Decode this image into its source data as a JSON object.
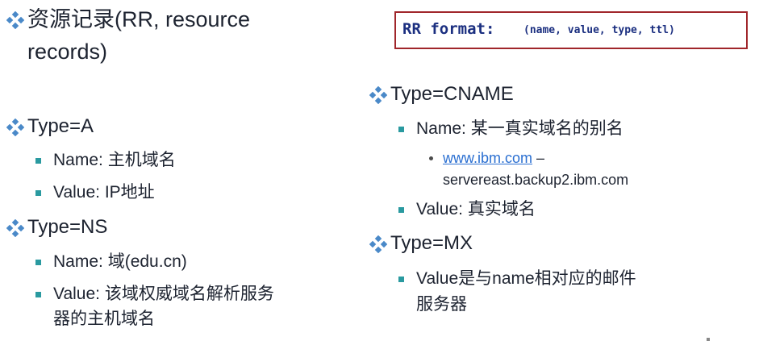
{
  "colors": {
    "text": "#1d2330",
    "bullet_square": "#2a9aa0",
    "diamond": "#4a89c8",
    "box_border": "#a0262b",
    "box_text": "#1b2f80",
    "link": "#2a6fd1"
  },
  "left": {
    "heading_line1": "资源记录(RR, resource",
    "heading_line2": "records)",
    "type_a": {
      "title": "Type=A",
      "name_key": "Name",
      "name_val": ": 主机域名",
      "value_key": "Value",
      "value_val": ": IP地址"
    },
    "type_ns": {
      "title": "Type=NS",
      "name_key": "Name",
      "name_val": ": 域(edu.cn)",
      "value_key": "Value",
      "value_val": ": 该域权威域名解析服务",
      "value_cont": "器的主机域名"
    }
  },
  "right": {
    "format_box": {
      "title": "RR format:",
      "args": "(name, value, type, ttl)"
    },
    "type_cname": {
      "title": "Type=CNAME",
      "name_key": "Name",
      "name_val": ": 某一真实域名的别名",
      "example_link": "www.ibm.com",
      "example_dash": " –",
      "example_target": "servereast.backup2.ibm.com",
      "value_key": "Value",
      "value_val": ": 真实域名"
    },
    "type_mx": {
      "title": "Type=MX",
      "value_key": "Value",
      "value_val": "是与name相对应的邮件",
      "value_cont": "服务器"
    }
  }
}
